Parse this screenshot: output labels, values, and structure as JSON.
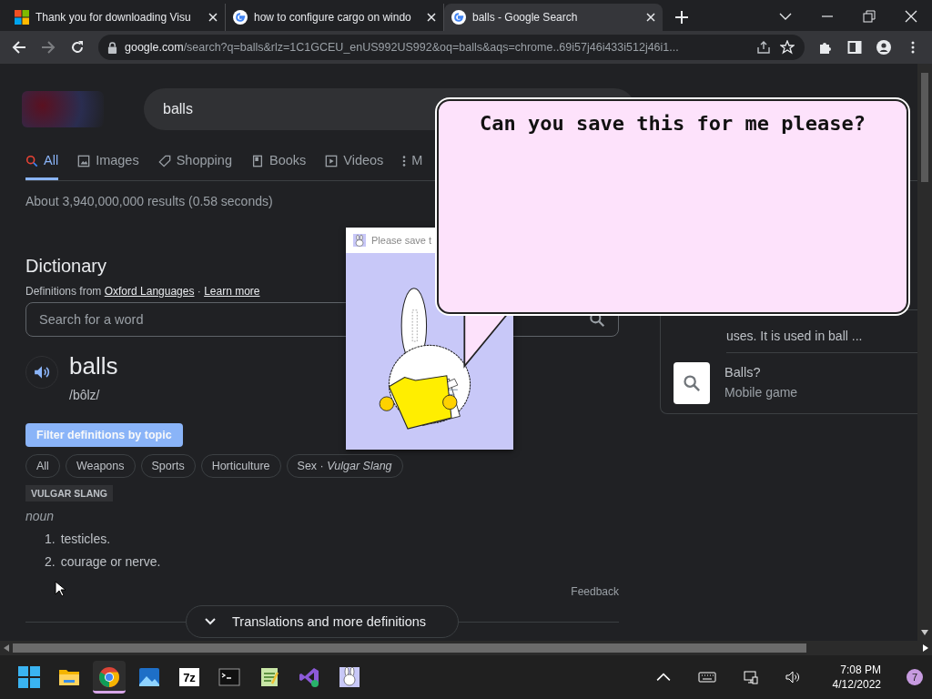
{
  "browser": {
    "tabs": [
      {
        "title": "Thank you for downloading Visu",
        "selected": false
      },
      {
        "title": "how to configure cargo on windo",
        "selected": false
      },
      {
        "title": "balls - Google Search",
        "selected": true
      }
    ],
    "address": {
      "host": "google.com",
      "path": "/search?q=balls&rlz=1C1GCEU_enUS992US992&oq=balls&aqs=chrome..69i57j46i433i512j46i1..."
    }
  },
  "search": {
    "query": "balls"
  },
  "nav_tabs": [
    {
      "label": "All",
      "selected": true
    },
    {
      "label": "Images",
      "selected": false
    },
    {
      "label": "Shopping",
      "selected": false
    },
    {
      "label": "Books",
      "selected": false
    },
    {
      "label": "Videos",
      "selected": false
    },
    {
      "label": "M",
      "selected": false
    }
  ],
  "result_stats": "About 3,940,000,000 results (0.58 seconds)",
  "dictionary": {
    "heading": "Dictionary",
    "source_prefix": "Definitions from",
    "source_link": "Oxford Languages",
    "separator": "·",
    "learn_more": "Learn more",
    "search_placeholder": "Search for a word",
    "word": "balls",
    "pronunciation": "/bôlz/",
    "filter_tip": "Filter definitions by topic",
    "topics": [
      "All",
      "Weapons",
      "Sports",
      "Horticulture",
      "Sex · *Vulgar Slang*"
    ],
    "register": "VULGAR SLANG",
    "part_of_speech": "noun",
    "senses": [
      {
        "number": "1.",
        "text": "testicles."
      },
      {
        "number": "2.",
        "text": "courage or nerve."
      }
    ],
    "feedback": "Feedback",
    "more_button": "Translations and more definitions"
  },
  "side_panel": {
    "snippet": "uses. It is used in ball ...",
    "items": [
      {
        "title": "Balls?",
        "subtitle": "Mobile game"
      }
    ]
  },
  "popup": {
    "title": "Please save t",
    "message": "Can you save this for me please?"
  },
  "taskbar": {
    "apps": [
      {
        "kind": "explorer",
        "active": false
      },
      {
        "kind": "chrome",
        "active": true
      },
      {
        "kind": "photos",
        "active": false
      },
      {
        "kind": "archiver",
        "label": "7z",
        "active": false
      },
      {
        "kind": "terminal",
        "active": false
      },
      {
        "kind": "notepad",
        "active": false
      },
      {
        "kind": "studio",
        "active": false
      },
      {
        "kind": "bunny",
        "active": false
      }
    ],
    "time": "7:08 PM",
    "date": "4/12/2022",
    "notifications": "7"
  }
}
